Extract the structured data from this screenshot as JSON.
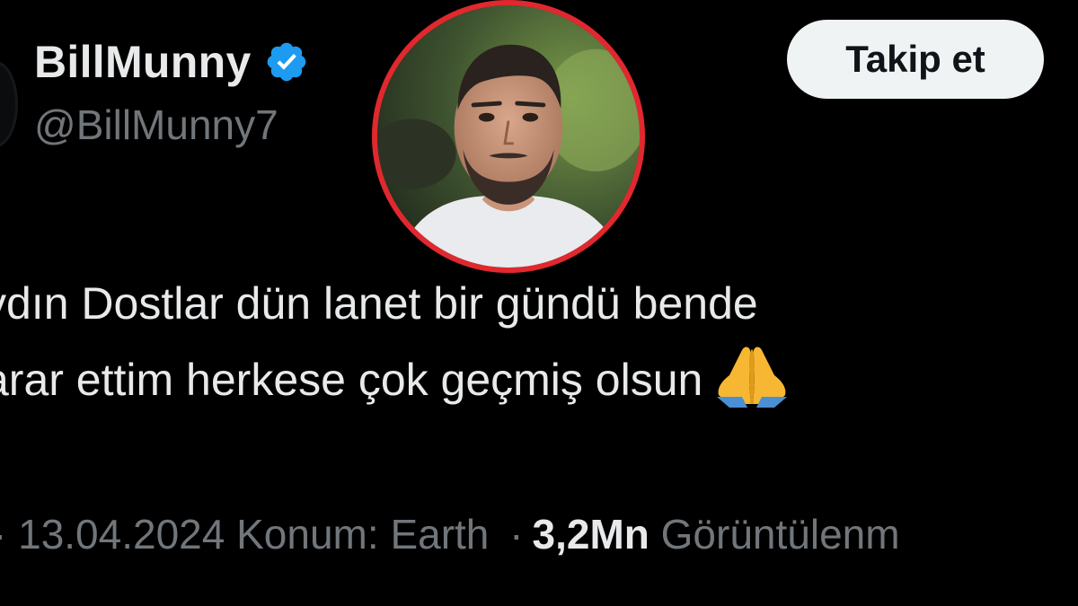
{
  "user": {
    "display_name": "BillMunny",
    "handle": "@BillMunny7",
    "verified": true
  },
  "follow_button": {
    "label": "Takip et"
  },
  "tweet": {
    "lines": [
      "ydın Dostlar dün lanet bir gündü  bende",
      "arar ettim herkese çok geçmiş olsun"
    ],
    "emoji": "folded-hands"
  },
  "meta": {
    "separator": "·",
    "date": "13.04.2024",
    "location_label": "Konum:",
    "location_value": "Earth",
    "views_count": "3,2Mn",
    "views_label": "Görüntülenm"
  },
  "colors": {
    "background": "#000000",
    "text_primary": "#e7e9ea",
    "text_secondary": "#71767b",
    "verified_badge": "#1d9bf0",
    "follow_button_bg": "#eff3f4",
    "highlight_ring": "#e0282e"
  },
  "icons": {
    "verified": "verified-badge-icon",
    "pray": "folded-hands-icon"
  }
}
